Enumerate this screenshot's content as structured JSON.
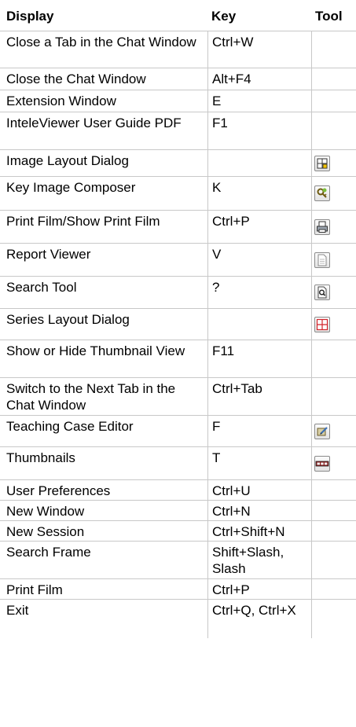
{
  "header": {
    "display": "Display",
    "key": "Key",
    "tool": "Tool"
  },
  "rows": [
    {
      "display": "Close a Tab in the Chat Window",
      "key": "Ctrl+W",
      "tool": ""
    },
    {
      "display": "Close the Chat Window",
      "key": "Alt+F4",
      "tool": ""
    },
    {
      "display": "Extension Window",
      "key": "E",
      "tool": ""
    },
    {
      "display": "InteleViewer User Guide PDF",
      "key": "F1",
      "tool": ""
    },
    {
      "display": "Image Layout Dialog",
      "key": "",
      "tool": "image-layout-icon"
    },
    {
      "display": "Key Image Composer",
      "key": "K",
      "tool": "key-image-composer-icon"
    },
    {
      "display": "Print Film/Show Print Film",
      "key": "Ctrl+P",
      "tool": "print-film-icon"
    },
    {
      "display": "Report Viewer",
      "key": "V",
      "tool": "report-viewer-icon"
    },
    {
      "display": "Search Tool",
      "key": "?",
      "tool": "search-tool-icon"
    },
    {
      "display": "Series Layout Dialog",
      "key": "",
      "tool": "series-layout-icon"
    },
    {
      "display": "Show or Hide Thumbnail View",
      "key": "F11",
      "tool": ""
    },
    {
      "display": "Switch to the Next Tab in the Chat Window",
      "key": "Ctrl+Tab",
      "tool": ""
    },
    {
      "display": "Teaching Case Editor",
      "key": "F",
      "tool": "teaching-case-editor-icon"
    },
    {
      "display": "Thumbnails",
      "key": "T",
      "tool": "thumbnails-icon"
    },
    {
      "display": "User Preferences",
      "key": "Ctrl+U",
      "tool": ""
    },
    {
      "display": "New Window",
      "key": "Ctrl+N",
      "tool": ""
    },
    {
      "display": "New Session",
      "key": "Ctrl+Shift+N",
      "tool": ""
    },
    {
      "display": "Search Frame",
      "key": "Shift+Slash, Slash",
      "tool": ""
    },
    {
      "display": "Print Film",
      "key": "Ctrl+P",
      "tool": ""
    },
    {
      "display": "Exit",
      "key": "Ctrl+Q, Ctrl+X",
      "tool": ""
    }
  ]
}
